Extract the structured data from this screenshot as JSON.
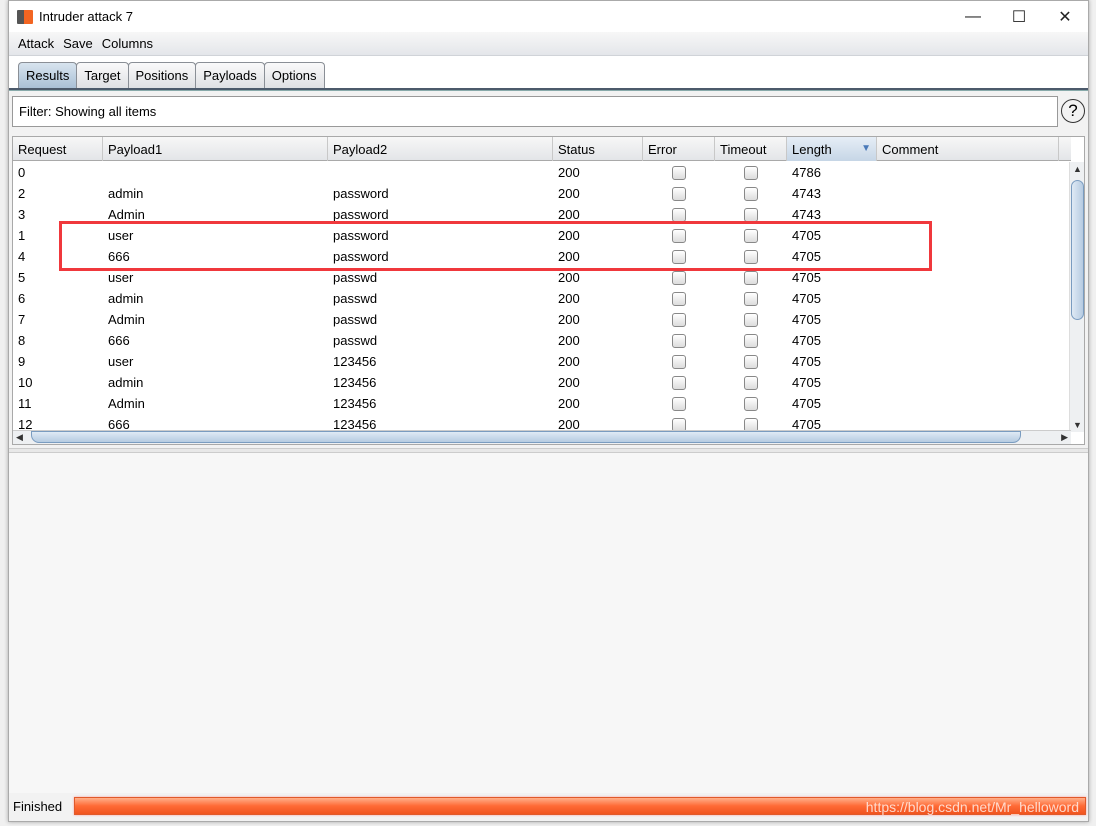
{
  "window": {
    "title": "Intruder attack 7",
    "minimize": "—",
    "maximize": "☐",
    "close": "✕"
  },
  "menu": [
    "Attack",
    "Save",
    "Columns"
  ],
  "tabs": [
    {
      "label": "Results",
      "active": true
    },
    {
      "label": "Target"
    },
    {
      "label": "Positions"
    },
    {
      "label": "Payloads"
    },
    {
      "label": "Options"
    }
  ],
  "filter": {
    "text": "Filter: Showing all items",
    "help": "?"
  },
  "table": {
    "columns": [
      "Request",
      "Payload1",
      "Payload2",
      "Status",
      "Error",
      "Timeout",
      "Length",
      "Comment"
    ],
    "sorted_column": "Length",
    "sort_direction": "descending",
    "rows": [
      [
        "0",
        "",
        "",
        "200",
        false,
        false,
        "4786",
        ""
      ],
      [
        "2",
        "admin",
        "password",
        "200",
        false,
        false,
        "4743",
        ""
      ],
      [
        "3",
        "Admin",
        "password",
        "200",
        false,
        false,
        "4743",
        ""
      ],
      [
        "1",
        "user",
        "password",
        "200",
        false,
        false,
        "4705",
        ""
      ],
      [
        "4",
        "666",
        "password",
        "200",
        false,
        false,
        "4705",
        ""
      ],
      [
        "5",
        "user",
        "passwd",
        "200",
        false,
        false,
        "4705",
        ""
      ],
      [
        "6",
        "admin",
        "passwd",
        "200",
        false,
        false,
        "4705",
        ""
      ],
      [
        "7",
        "Admin",
        "passwd",
        "200",
        false,
        false,
        "4705",
        ""
      ],
      [
        "8",
        "666",
        "passwd",
        "200",
        false,
        false,
        "4705",
        ""
      ],
      [
        "9",
        "user",
        "123456",
        "200",
        false,
        false,
        "4705",
        ""
      ],
      [
        "10",
        "admin",
        "123456",
        "200",
        false,
        false,
        "4705",
        ""
      ],
      [
        "11",
        "Admin",
        "123456",
        "200",
        false,
        false,
        "4705",
        ""
      ],
      [
        "12",
        "666",
        "123456",
        "200",
        false,
        false,
        "4705",
        ""
      ]
    ],
    "highlight_color": "#f0383c"
  },
  "status": {
    "text": "Finished",
    "progress_percent": 100,
    "color": "#ff6a35"
  },
  "watermark": "https://blog.csdn.net/Mr_helloword"
}
